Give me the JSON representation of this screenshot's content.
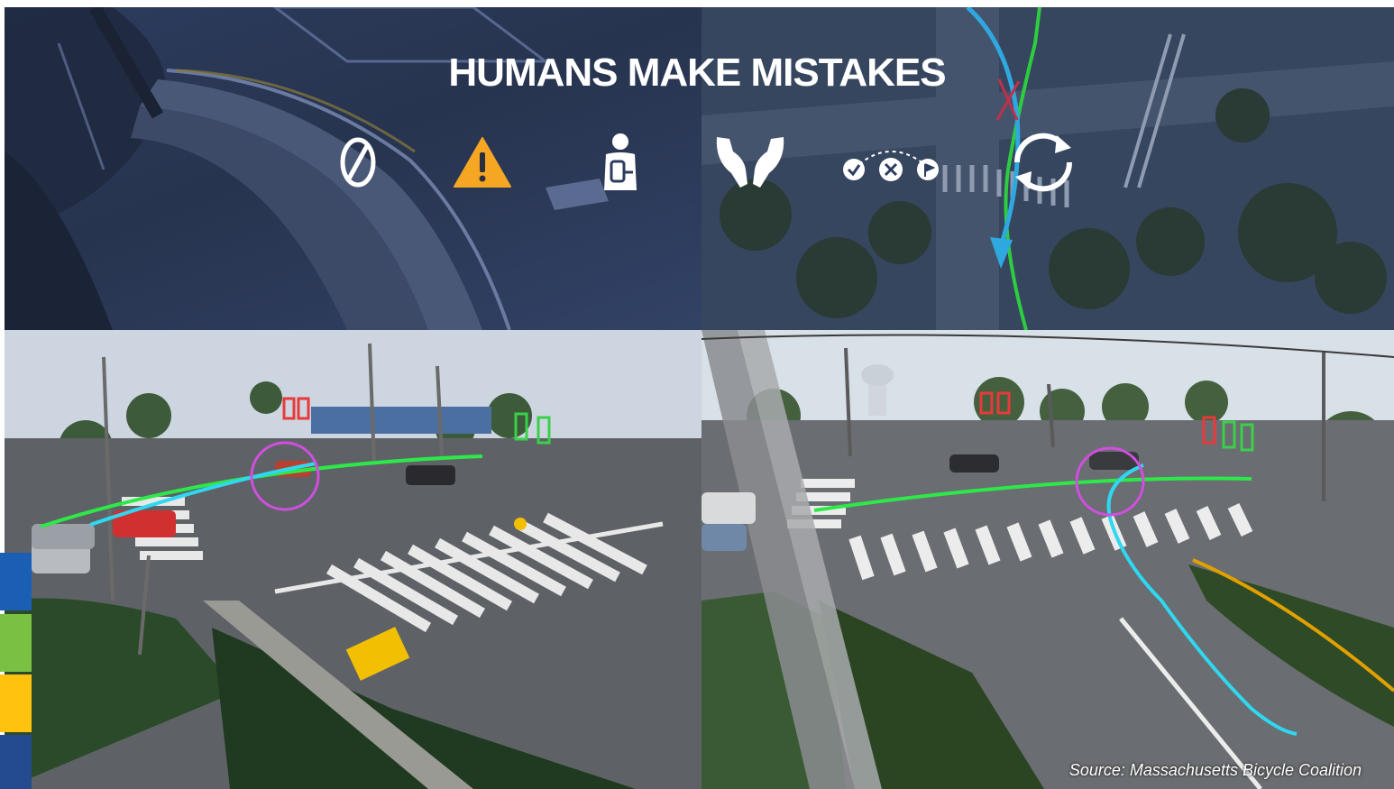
{
  "title": "HUMANS MAKE MISTAKES",
  "source": "Source: Massachusetts Bicycle Coalition",
  "icons": [
    "zero-icon",
    "warning-icon",
    "distracted-driver-icon",
    "open-hands-icon",
    "interrupted-path-icon",
    "cycle-arrows-icon"
  ],
  "colors": {
    "title": "#ffffff",
    "warning": "#f5a623",
    "trajectory_green": "#2ee84a",
    "trajectory_cyan": "#2fd8f0",
    "highlight_circle": "#d14fe0",
    "signal_red": "#e83a3a",
    "signal_green": "#3ad04a",
    "accent_blue": "#1a5fb4",
    "accent_green": "#7ac143",
    "accent_yellow": "#ffc20e",
    "accent_navy": "#244a8f"
  },
  "accent_bars": [
    "blue",
    "green",
    "yellow",
    "navy"
  ]
}
